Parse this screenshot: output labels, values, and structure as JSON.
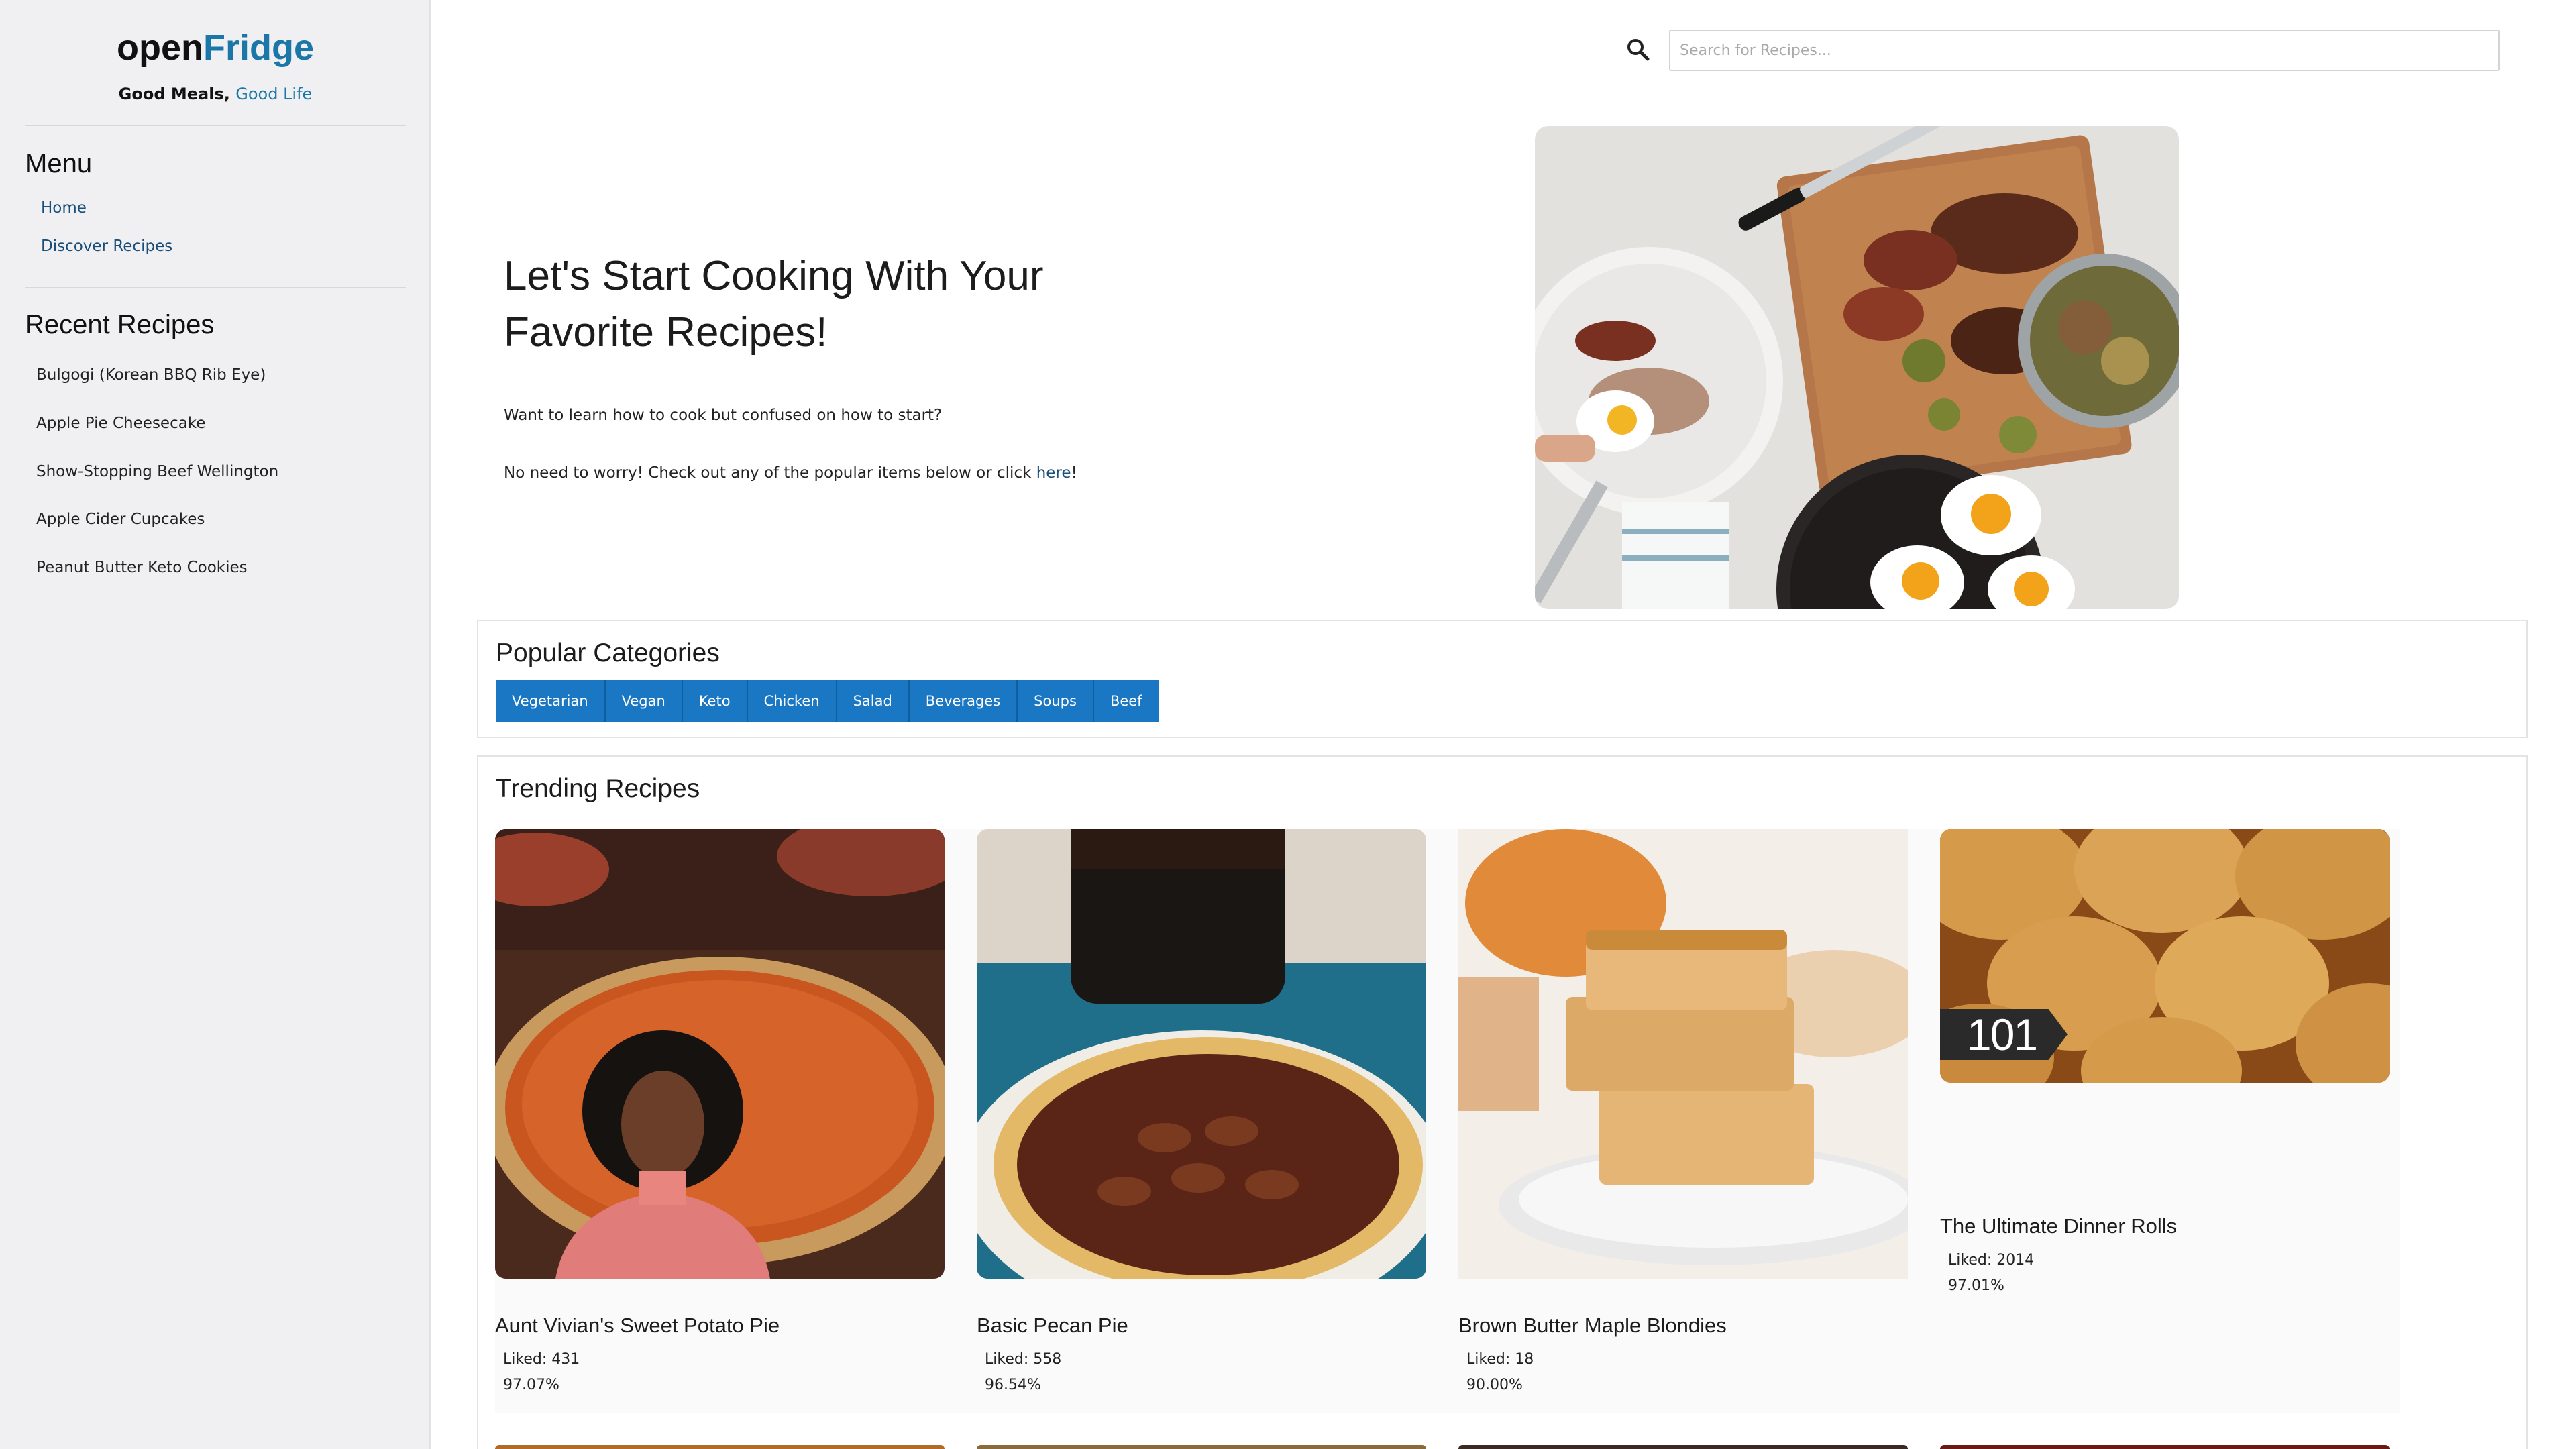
{
  "brand": {
    "name_part1": "open",
    "name_part2": "Fridge",
    "tagline_part1": "Good Meals,",
    "tagline_part2": "Good Life"
  },
  "sidebar": {
    "menu_heading": "Menu",
    "menu_items": [
      {
        "label": "Home"
      },
      {
        "label": "Discover Recipes"
      }
    ],
    "recent_heading": "Recent Recipes",
    "recent_items": [
      {
        "label": "Bulgogi (Korean BBQ Rib Eye)"
      },
      {
        "label": "Apple Pie Cheesecake"
      },
      {
        "label": "Show-Stopping Beef Wellington"
      },
      {
        "label": "Apple Cider Cupcakes"
      },
      {
        "label": "Peanut Butter Keto Cookies"
      }
    ]
  },
  "search": {
    "placeholder": "Search for Recipes...",
    "value": ""
  },
  "hero": {
    "title": "Let's Start Cooking With Your Favorite Recipes!",
    "line1": "Want to learn how to cook but confused on how to start?",
    "line2_prefix": "No need to worry! Check out any of the popular items below or click",
    "line2_link": "here",
    "line2_suffix": "!"
  },
  "categories": {
    "heading": "Popular Categories",
    "items": [
      "Vegetarian",
      "Vegan",
      "Keto",
      "Chicken",
      "Salad",
      "Beverages",
      "Soups",
      "Beef"
    ]
  },
  "trending": {
    "heading": "Trending Recipes",
    "recipes": [
      {
        "title": "Aunt Vivian's Sweet Potato Pie",
        "liked": "Liked: 431",
        "rating": "97.07%"
      },
      {
        "title": "Basic Pecan Pie",
        "liked": "Liked: 558",
        "rating": "96.54%"
      },
      {
        "title": "Brown Butter Maple Blondies",
        "liked": "Liked: 18",
        "rating": "90.00%"
      },
      {
        "title": "The Ultimate Dinner Rolls",
        "liked": "Liked: 2014",
        "rating": "97.01%",
        "badge": "101"
      }
    ]
  },
  "colors": {
    "accent": "#1a77a8",
    "category_button": "#1a77c4",
    "sidebar_bg": "#f0f0f2",
    "link": "#1a4f7a"
  }
}
